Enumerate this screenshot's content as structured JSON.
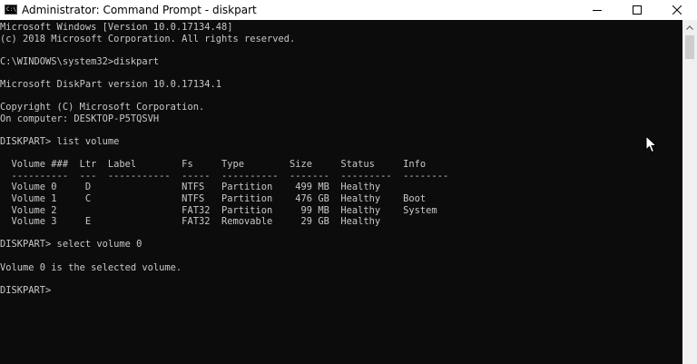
{
  "window": {
    "title": "Administrator: Command Prompt - diskpart",
    "icon_glyph": "C:\\"
  },
  "console": {
    "lines": [
      "Microsoft Windows [Version 10.0.17134.48]",
      "(c) 2018 Microsoft Corporation. All rights reserved.",
      "",
      "C:\\WINDOWS\\system32>diskpart",
      "",
      "Microsoft DiskPart version 10.0.17134.1",
      "",
      "Copyright (C) Microsoft Corporation.",
      "On computer: DESKTOP-P5TQSVH",
      "",
      "DISKPART> list volume",
      "",
      "  Volume ###  Ltr  Label        Fs     Type        Size     Status     Info",
      "  ----------  ---  -----------  -----  ----------  -------  ---------  --------",
      "  Volume 0     D                NTFS   Partition    499 MB  Healthy",
      "  Volume 1     C                NTFS   Partition    476 GB  Healthy    Boot",
      "  Volume 2                      FAT32  Partition     99 MB  Healthy    System",
      "  Volume 3     E                FAT32  Removable     29 GB  Healthy",
      "",
      "DISKPART> select volume 0",
      "",
      "Volume 0 is the selected volume.",
      "",
      "DISKPART>"
    ]
  },
  "colors": {
    "console_bg": "#0c0c0c",
    "console_text": "#c8c8c8",
    "titlebar_bg": "#ffffff"
  },
  "icons": {
    "app": "command-prompt-icon",
    "minimize": "minimize-icon",
    "maximize": "maximize-icon",
    "close": "close-icon",
    "scroll_up": "chevron-up-icon",
    "pointer": "mouse-pointer-icon"
  }
}
